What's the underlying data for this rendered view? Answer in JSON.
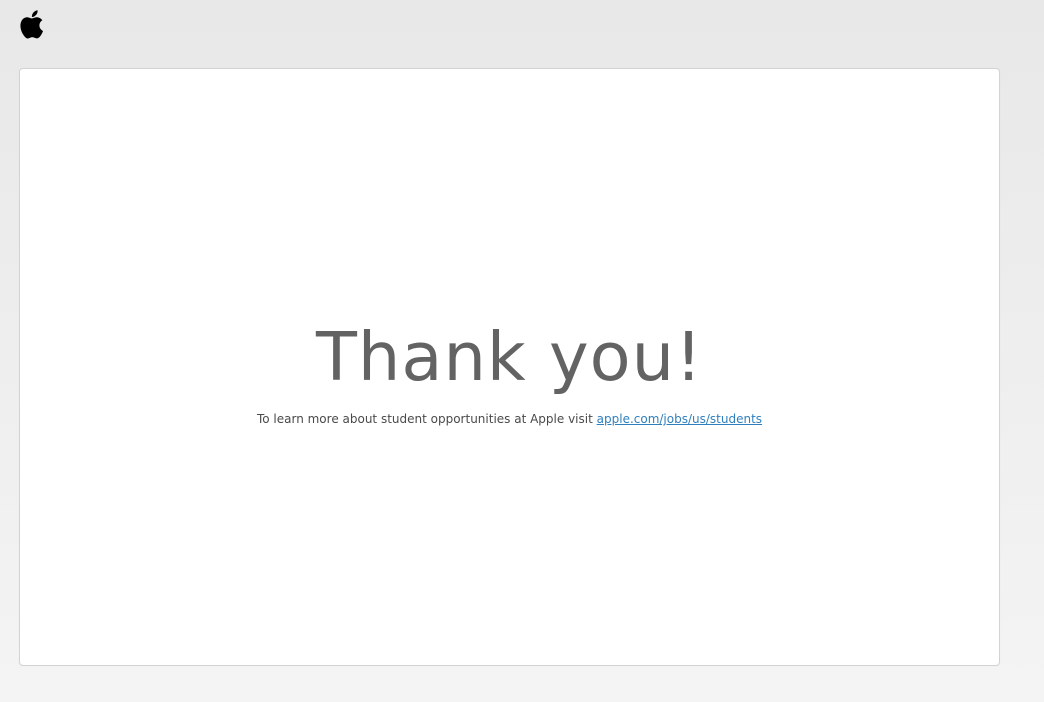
{
  "header": {
    "logo_icon": "apple-logo-icon"
  },
  "main": {
    "title": "Thank you!",
    "message": "To learn more about student opportunities at Apple visit",
    "link_text": "apple.com/jobs/us/students"
  },
  "colors": {
    "background": "#ececec",
    "card": "#ffffff",
    "headline": "#636363",
    "link": "#2f7fbd"
  }
}
